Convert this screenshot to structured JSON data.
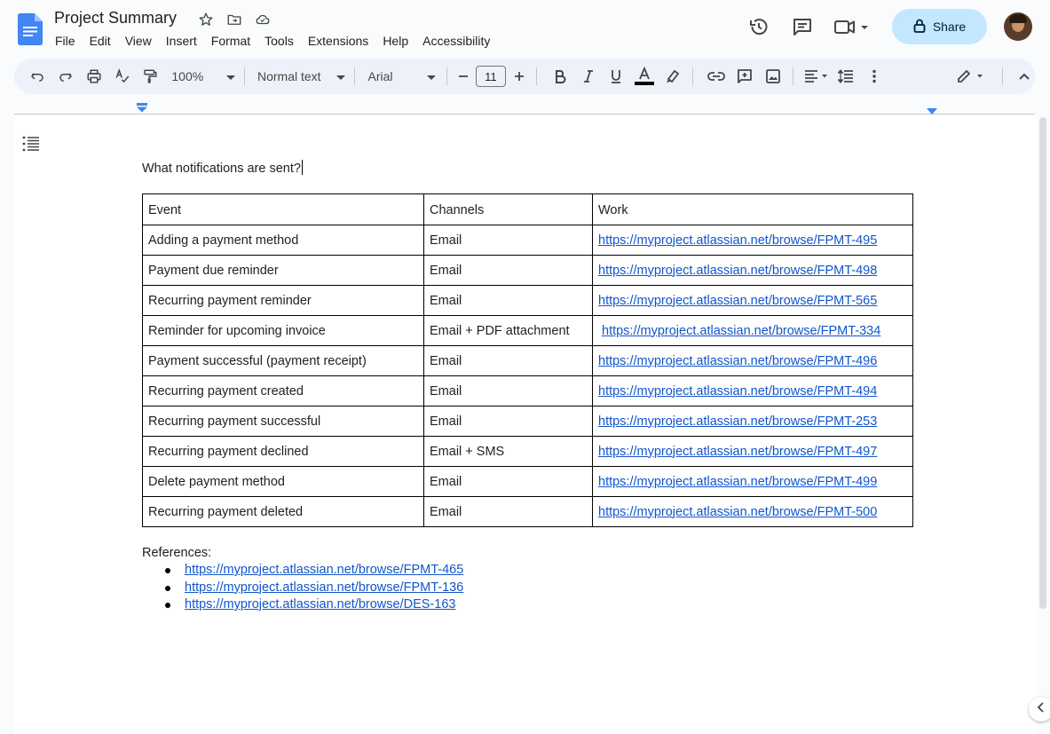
{
  "app": {
    "doc_title": "Project Summary",
    "menu": [
      "File",
      "Edit",
      "View",
      "Insert",
      "Format",
      "Tools",
      "Extensions",
      "Help",
      "Accessibility"
    ],
    "share_label": "Share"
  },
  "toolbar": {
    "zoom": "100%",
    "style": "Normal text",
    "font": "Arial",
    "font_size": "11"
  },
  "document": {
    "question": "What notifications are sent?",
    "table": {
      "headers": [
        "Event",
        "Channels",
        "Work"
      ],
      "rows": [
        [
          "Adding a payment method",
          "Email",
          "https://myproject.atlassian.net/browse/FPMT-495"
        ],
        [
          "Payment due reminder",
          "Email",
          "https://myproject.atlassian.net/browse/FPMT-498"
        ],
        [
          "Recurring payment reminder",
          "Email",
          "https://myproject.atlassian.net/browse/FPMT-565"
        ],
        [
          "Reminder for upcoming invoice",
          "Email + PDF attachment",
          "https://myproject.atlassian.net/browse/FPMT-334"
        ],
        [
          "Payment successful (payment receipt)",
          "Email",
          "https://myproject.atlassian.net/browse/FPMT-496"
        ],
        [
          "Recurring payment created",
          "Email",
          "https://myproject.atlassian.net/browse/FPMT-494"
        ],
        [
          "Recurring payment successful",
          "Email",
          "https://myproject.atlassian.net/browse/FPMT-253"
        ],
        [
          "Recurring payment declined",
          "Email + SMS",
          "https://myproject.atlassian.net/browse/FPMT-497"
        ],
        [
          "Delete payment method",
          "Email",
          "https://myproject.atlassian.net/browse/FPMT-499"
        ],
        [
          "Recurring payment deleted",
          "Email",
          "https://myproject.atlassian.net/browse/FPMT-500"
        ]
      ]
    },
    "references_label": "References:",
    "references": [
      "https://myproject.atlassian.net/browse/FPMT-465",
      "https://myproject.atlassian.net/browse/FPMT-136",
      "https://myproject.atlassian.net/browse/DES-163"
    ]
  },
  "colors": {
    "link": "#1155cc",
    "share_bg": "#c2e7ff",
    "toolbar_bg": "#edf2fa",
    "docs_blue": "#4285f4"
  }
}
